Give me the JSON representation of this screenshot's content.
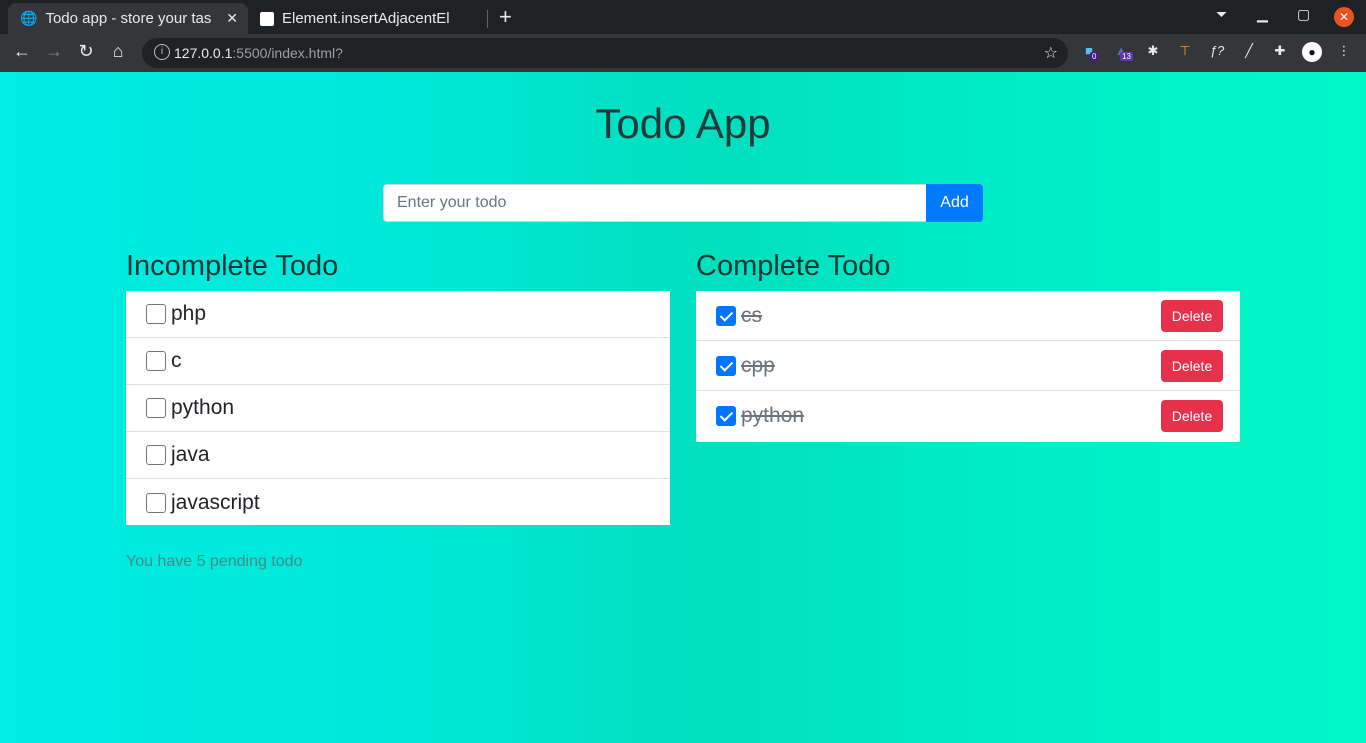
{
  "browser": {
    "tabs": [
      {
        "title": "Todo app - store your tas",
        "active": true
      },
      {
        "title": "Element.insertAdjacentEl",
        "active": false
      }
    ],
    "url_host": "127.0.0.1",
    "url_rest": ":5500/index.html?",
    "extension_badges": {
      "first": "0",
      "second": "13"
    }
  },
  "app": {
    "title": "Todo App",
    "input_placeholder": "Enter your todo",
    "add_label": "Add",
    "incomplete_heading": "Incomplete Todo",
    "complete_heading": "Complete Todo",
    "incomplete": [
      "php",
      "c",
      "python",
      "java",
      "javascript"
    ],
    "complete": [
      "cs",
      "cpp",
      "python"
    ],
    "delete_label": "Delete",
    "pending_text": "You have 5 pending todo"
  },
  "colors": {
    "accent": "#007bff",
    "danger": "#e7304a",
    "gradient_start": "#00ece4",
    "gradient_end": "#00f8c8"
  }
}
